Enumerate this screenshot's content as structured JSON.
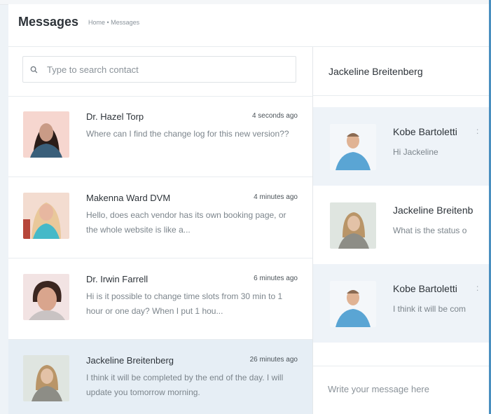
{
  "header": {
    "title": "Messages",
    "breadcrumb": "Home • Messages"
  },
  "search": {
    "placeholder": "Type to search contact",
    "icon": "search-icon"
  },
  "contacts": [
    {
      "name": "Dr. Hazel Torp",
      "time": "4 seconds ago",
      "message": "Where can I find the change log for this new version??",
      "avatar_colors": [
        "#f6d6cf",
        "#2a1c18",
        "#c99b86",
        "#3a5f7a"
      ]
    },
    {
      "name": "Makenna Ward DVM",
      "time": "4 minutes ago",
      "message": "Hello, does each vendor has its own booking page, or the whole website is like a...",
      "avatar_colors": [
        "#f3dcd0",
        "#e9c89a",
        "#e7b7a0",
        "#45b9c8"
      ]
    },
    {
      "name": "Dr. Irwin Farrell",
      "time": "6 minutes ago",
      "message": "Hi is it possible to change time slots from 30 min to 1 hour or one day? When I put 1 hou...",
      "avatar_colors": [
        "#f2e3e3",
        "#3b2620",
        "#d9a58d",
        "#c9c3c3"
      ]
    },
    {
      "name": "Jackeline Breitenberg",
      "time": "26 minutes ago",
      "message": "I think it will be completed by the end of the day. I will update you tomorrow morning.",
      "avatar_colors": [
        "#dfe5e0",
        "#b99568",
        "#e3c2a7",
        "#8d8d86"
      ]
    }
  ],
  "chat": {
    "contact_name": "Jackeline Breitenberg",
    "messages": [
      {
        "sender": "Kobe Bartoletti",
        "meta": ":",
        "text": "Hi Jackeline",
        "highlight": true
      },
      {
        "sender": "Jackeline Breitenb",
        "meta": "",
        "text": "What is the status o",
        "highlight": false
      },
      {
        "sender": "Kobe Bartoletti",
        "meta": ":",
        "text": "I think it will be com",
        "highlight": true
      }
    ],
    "composer_placeholder": "Write your message here"
  },
  "colors": {
    "active_row": "#e6eef5",
    "chat_tint": "#eef3f8",
    "accent_edge": "#4a8fbf"
  }
}
